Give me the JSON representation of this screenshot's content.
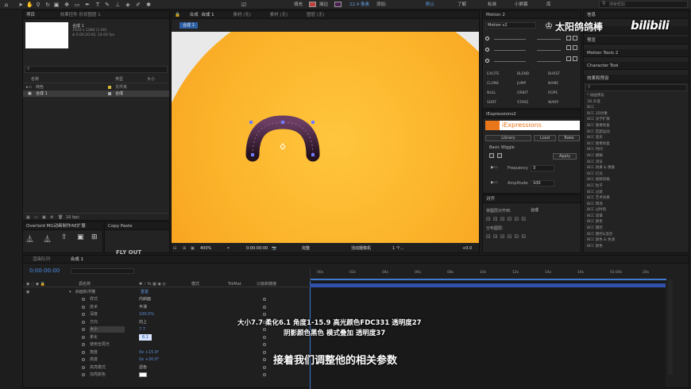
{
  "toolbar": {
    "fill_label": "填充",
    "stroke_label": "描边",
    "stroke_px": "22.4 像素",
    "add_label": "添加:",
    "workspaces": [
      "默认",
      "了解",
      "标准",
      "小屏幕",
      "库"
    ],
    "search_hint": "搜索帮助"
  },
  "project": {
    "tab": "项目",
    "effects_tab": "效果控件 形状图层 1",
    "comp_name": "合成 1",
    "comp_dims": "1920 x 1080 (1.00)",
    "comp_duration": "Δ 0:00:20:00, 24.00 fps",
    "col_name": "名称",
    "col_type": "类型",
    "col_size": "大小",
    "items": [
      {
        "name": "纯色",
        "type": "文件夹"
      },
      {
        "name": "合成 1",
        "type": "合成"
      }
    ],
    "bpc": "16 bpc"
  },
  "overlord": {
    "tab": "Overlord  MG动画制作AE扩展",
    "copy_tab": "Copy Paste",
    "flyout": "FLY OUT"
  },
  "comp_viewer": {
    "tab_comp": "合成",
    "tab_comp_name": "合成 1",
    "tab_footage": "素材 (无)",
    "tab_layer": "图层 (无)",
    "tab_layer2": "素材 (无)",
    "breadcrumb": "合成 1",
    "zoom": "400%",
    "timecode": "0:00:00:00",
    "quality": "完整",
    "camera": "活动摄像机",
    "views": "1 个...",
    "exposure": "+0.0"
  },
  "motion2": {
    "tab": "Motion 2",
    "preset": "Motion v2",
    "buttons": [
      "EXCITE",
      "BLEND",
      "BURST",
      "CLONE",
      "JUMP",
      "NAME",
      "NULL",
      "ORBIT",
      "ROPE",
      "SORT",
      "STARE",
      "WARP"
    ]
  },
  "iexpr": {
    "tab": "iExpressions2",
    "logo": "iExpressions",
    "btn_library": "Library",
    "btn_load": "Load",
    "btn_bake": "Bake",
    "section": "Basic Wiggle",
    "apply": "Apply",
    "freq_label": "Frequency",
    "freq_val": "3",
    "amp_label": "Amplitude",
    "amp_val": "100"
  },
  "align": {
    "tab": "对齐",
    "label": "将图层对齐到:",
    "target": "合成",
    "distribute": "分布图层:"
  },
  "right_panels": {
    "info": "信息",
    "audio": "音频",
    "preview": "预览",
    "motion_tools": "Motion Tools 2",
    "character_tool": "Character Tool",
    "effects": "效果和预设",
    "effects_list": [
      "* 动画预设",
      "3D 声道",
      "BCC",
      "BCC 3D对象",
      "BCC 光学扩散",
      "BCC 图像恢复",
      "BCC 匹配运动",
      "BCC 变形",
      "BCC 图像恢复",
      "BCC 时间",
      "BCC 模糊",
      "BCC 浏览",
      "BCC 效果 & 像素",
      "BCC 灯光",
      "BCC 视频风格",
      "BCC 粒子",
      "BCC 过渡",
      "BCC 艺术效果",
      "BCC 转场",
      "BCC 过时的",
      "BCC 遮罩",
      "BCC 颜色",
      "BCC 键控",
      "BCC 键控&混合",
      "BCC 颜色 & 色调",
      "BCC 颜色"
    ]
  },
  "timeline": {
    "tab_render": "渲染队列",
    "tab_comp": "合成 1",
    "timecode": "0:00:00:00",
    "col_source": "源名称",
    "col_mode": "模式",
    "col_trkmat": "TrkMat",
    "col_parent": "父级和链接",
    "layer_group": "斜面和浮雕",
    "layer_group_val": "重置",
    "props": [
      {
        "name": "样式",
        "value": "内斜面"
      },
      {
        "name": "技术",
        "value": "平滑"
      },
      {
        "name": "深度",
        "value": "100.0%"
      },
      {
        "name": "方向",
        "value": "向上"
      },
      {
        "name": "大小",
        "value": "7.7"
      },
      {
        "name": "柔化",
        "value": "6.1"
      },
      {
        "name": "使用全局光",
        "value": ""
      },
      {
        "name": "角度",
        "value": "0x +15.9°"
      },
      {
        "name": "高度",
        "value": "0x +30.0°"
      },
      {
        "name": "高亮模式",
        "value": "滤色"
      },
      {
        "name": "加亮颜色",
        "value": ""
      }
    ],
    "ruler": [
      "00s",
      "02s",
      "04s",
      "06s",
      "08s",
      "10s",
      "12s",
      "14s",
      "16s",
      "01:00s",
      "20s"
    ]
  },
  "subtitles": {
    "line1": "大小7.7  柔化6.1  角度1-15.9   高光颜色FDC331  透明度27",
    "line2": "阴影颜色黑色  模式叠加  透明度37",
    "line3": "接着我们调整他的相关参数"
  },
  "watermark": {
    "name": "太阳鸽鸽棒",
    "brand": "bilibili"
  },
  "colors": {
    "orange": "#f8a51a",
    "blue_accent": "#2a6fd6",
    "ie_orange": "#e8761b",
    "bg": "#1d1d1d"
  }
}
